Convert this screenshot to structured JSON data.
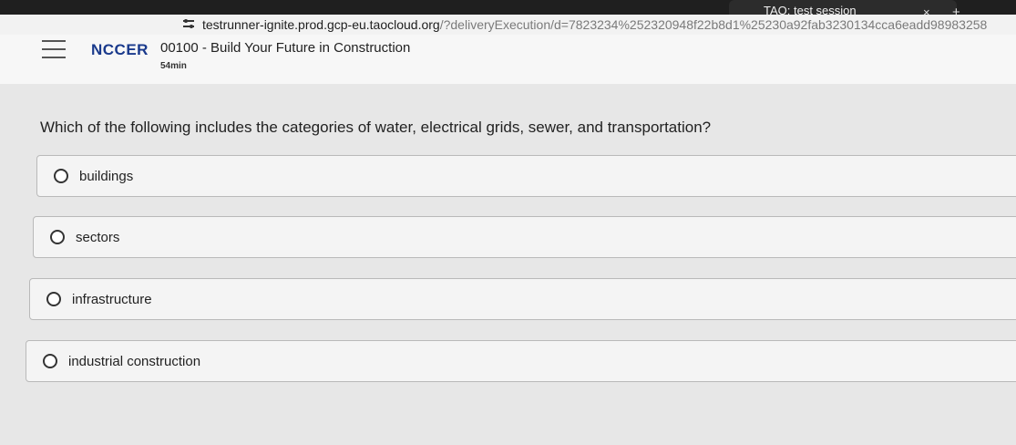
{
  "browser": {
    "tab_title": "TAO: test session",
    "tab_close": "×",
    "new_tab": "+",
    "url_host": "testrunner-ignite.prod.gcp-eu.taocloud.org",
    "url_path": "/?deliveryExecution/d=7823234%252320948f22b8d1%25230a92fab3230134cca6eadd98983258"
  },
  "header": {
    "logo": "NCCER",
    "course_title": "00100 - Build Your Future in Construction",
    "timer": "54min"
  },
  "question": {
    "text": "Which of the following includes the categories of water, electrical grids, sewer, and transportation?",
    "options": [
      {
        "label": "buildings"
      },
      {
        "label": "sectors"
      },
      {
        "label": "infrastructure"
      },
      {
        "label": "industrial construction"
      }
    ]
  },
  "colors": {
    "logo": "#1a3a8c",
    "page_bg": "#e7e7e7",
    "option_bg": "#f4f4f4"
  }
}
